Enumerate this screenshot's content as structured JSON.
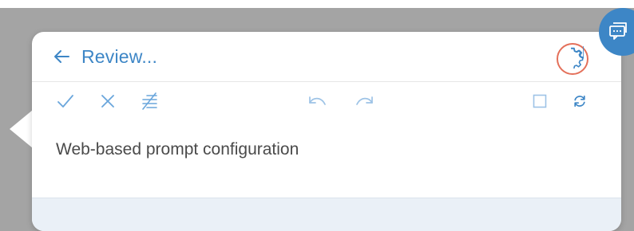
{
  "header": {
    "back_label": "Review..."
  },
  "body": {
    "text": "Web-based prompt configuration"
  },
  "icons": {
    "back": "arrow-left-icon",
    "settings": "gear-icon",
    "accept": "checkmark-icon",
    "reject": "close-icon",
    "clear_formatting": "strikethrough-lines-icon",
    "undo": "undo-icon",
    "redo": "redo-icon",
    "select": "checkbox-icon",
    "refresh": "refresh-icon",
    "chat": "chat-bubble-icon"
  },
  "colors": {
    "accent": "#3d86c6",
    "accent_muted": "#9dc3e6",
    "highlight_ring": "#e4705a",
    "backdrop": "#a4a4a4",
    "text": "#4a4a4a"
  }
}
